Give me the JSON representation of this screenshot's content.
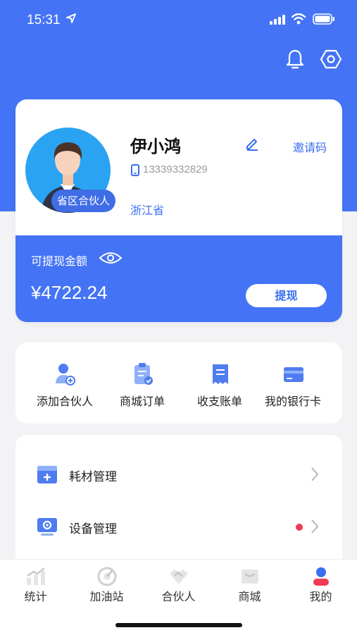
{
  "status_bar": {
    "time": "15:31"
  },
  "profile": {
    "name": "伊小鸿",
    "role_badge": "省区合伙人",
    "phone": "13339332829",
    "province": "浙江省",
    "invite_label": "邀请码"
  },
  "balance": {
    "label": "可提现金额",
    "amount": "¥4722.24",
    "withdraw_label": "提现"
  },
  "actions": [
    {
      "label": "添加合伙人",
      "icon": "add-partner-icon"
    },
    {
      "label": "商城订单",
      "icon": "clipboard-order-icon"
    },
    {
      "label": "收支账单",
      "icon": "receipt-icon"
    },
    {
      "label": "我的银行卡",
      "icon": "bank-card-icon"
    }
  ],
  "menu": [
    {
      "label": "耗材管理",
      "icon": "supplies-box-icon",
      "has_dot": false
    },
    {
      "label": "设备管理",
      "icon": "monitor-gear-icon",
      "has_dot": true
    }
  ],
  "tabs": [
    {
      "label": "统计",
      "icon": "chart-icon",
      "active": false
    },
    {
      "label": "加油站",
      "icon": "gauge-icon",
      "active": false
    },
    {
      "label": "合伙人",
      "icon": "handshake-icon",
      "active": false
    },
    {
      "label": "商城",
      "icon": "store-icon",
      "active": false
    },
    {
      "label": "我的",
      "icon": "profile-icon",
      "active": true
    }
  ],
  "colors": {
    "primary": "#4474f5",
    "accent_text": "#3b6ef0",
    "badge_dot": "#ef3b55"
  }
}
